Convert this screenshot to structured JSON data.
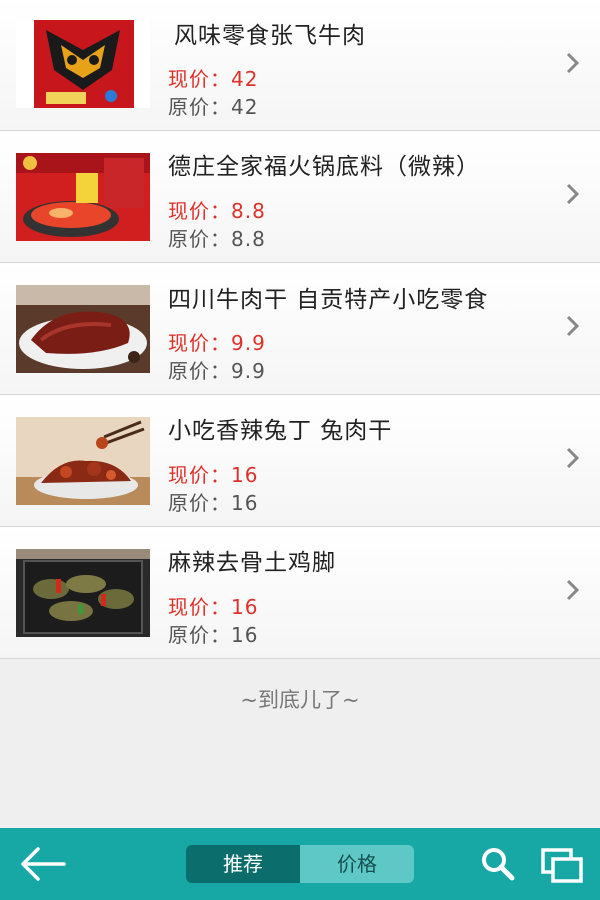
{
  "items": [
    {
      "title": "风味零食张飞牛肉",
      "price_now": "现价：42",
      "price_old": "原价：42",
      "image": "zhangfei-beef-package"
    },
    {
      "title": "德庄全家福火锅底料（微辣）",
      "price_now": "现价：8.8",
      "price_old": "原价：8.8",
      "image": "hotpot-base-package"
    },
    {
      "title": "四川牛肉干 自贡特产小吃零食",
      "price_now": "现价：9.9",
      "price_old": "原价：9.9",
      "image": "beef-jerky-plate"
    },
    {
      "title": "小吃香辣兔丁 兔肉干",
      "price_now": "现价：16",
      "price_old": "原价：16",
      "image": "spicy-rabbit-dish"
    },
    {
      "title": "麻辣去骨土鸡脚",
      "price_now": "现价：16",
      "price_old": "原价：16",
      "image": "spicy-chicken-feet"
    }
  ],
  "end_text": "~到底儿了~",
  "bottom_bar": {
    "tabs": [
      "推荐",
      "价格"
    ],
    "active_tab": "推荐",
    "icons": [
      "back-arrow-icon",
      "search-icon",
      "windows-icon"
    ],
    "bar_color": "#17a7a5",
    "active_color": "#0b6e6c"
  },
  "colors": {
    "price_now": "#e0302a",
    "price_old": "#555555"
  }
}
